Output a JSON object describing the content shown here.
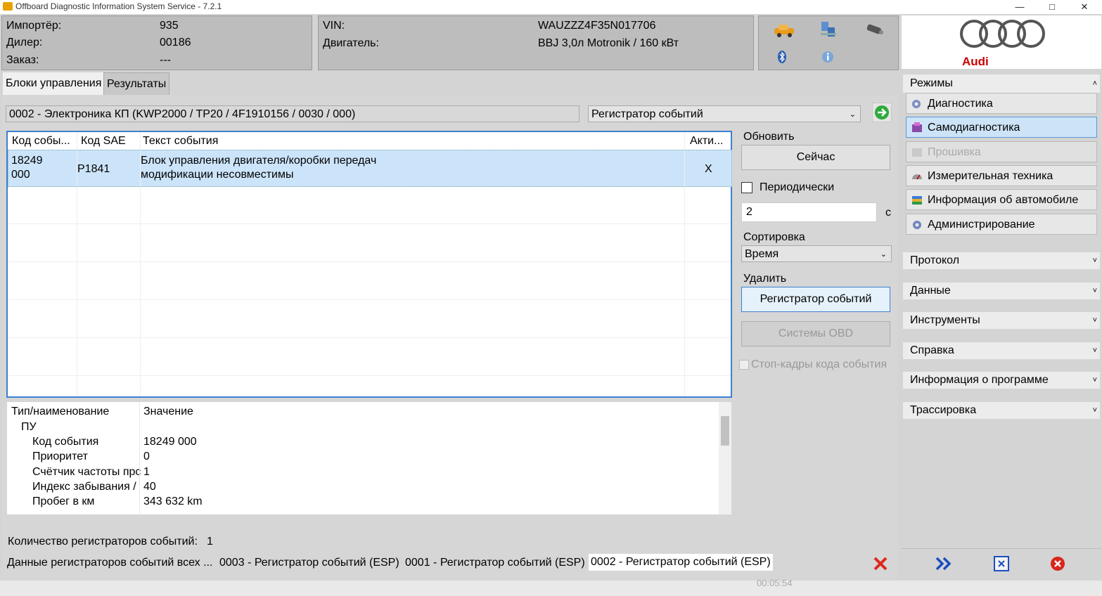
{
  "window": {
    "title": "Offboard Diagnostic Information System Service - 7.2.1"
  },
  "header": {
    "importer_label": "Импортёр:",
    "importer_value": "935",
    "dealer_label": "Дилер:",
    "dealer_value": "00186",
    "order_label": "Заказ:",
    "order_value": "---",
    "vin_label": "VIN:",
    "vin_value": "WAUZZZ4F35N017706",
    "engine_label": "Двигатель:",
    "engine_value": "BBJ 3,0л Motronik / 160 кВт"
  },
  "brand": {
    "name": "Audi"
  },
  "tabs": [
    "Блоки управления",
    "Результаты"
  ],
  "control_unit": {
    "selected": "0002 - Электроника КП  (KWP2000 / TP20 / 4F1910156 / 0030 / 000)",
    "mode_select": "Регистратор событий"
  },
  "event_table": {
    "columns": [
      "Код собы...",
      "Код SAE",
      "Текст события",
      "Акти..."
    ],
    "rows": [
      {
        "code1": "18249",
        "code2": "000",
        "sae": "P1841",
        "text1": "Блок управления двигателя/коробки передач",
        "text2": "модификации несовместимы",
        "active": "X"
      }
    ]
  },
  "controls": {
    "refresh_group": "Обновить",
    "now_button": "Сейчас",
    "periodic_label": "Периодически",
    "interval_value": "2",
    "interval_unit": "с",
    "sort_group": "Сортировка",
    "sort_value": "Время",
    "delete_group": "Удалить",
    "delete_event_button": "Регистратор событий",
    "obd_button": "Системы OBD",
    "freeze_frame_label": "Стоп-кадры кода события"
  },
  "details": {
    "col1": "Тип/наименование",
    "col2": "Значение",
    "group": "ПУ",
    "rows": [
      {
        "name": "Код события",
        "value": "18249 000"
      },
      {
        "name": "Приоритет",
        "value": "0"
      },
      {
        "name": "Счётчик частоты прс",
        "value": "1"
      },
      {
        "name": "Индекс забывания /",
        "value": "40"
      },
      {
        "name": "Пробег в км",
        "value": "343 632 km"
      }
    ]
  },
  "footer": {
    "count_label": "Количество регистраторов событий:",
    "count_value": "1",
    "all_label": "Данные регистраторов событий всех ...",
    "links": [
      "0003 - Регистратор событий (ESP)",
      "0001 - Регистратор событий (ESP)",
      "0002 - Регистратор событий (ESP)"
    ]
  },
  "sidebar": {
    "modes_title": "Режимы",
    "modes": [
      "Диагностика",
      "Самодиагностика",
      "Прошивка",
      "Измерительная техника",
      "Информация об автомобиле",
      "Администрирование"
    ],
    "sections": [
      "Протокол",
      "Данные",
      "Инструменты",
      "Справка",
      "Информация о программе",
      "Трассировка"
    ]
  },
  "statusbar": {
    "time": "00:05:54"
  }
}
